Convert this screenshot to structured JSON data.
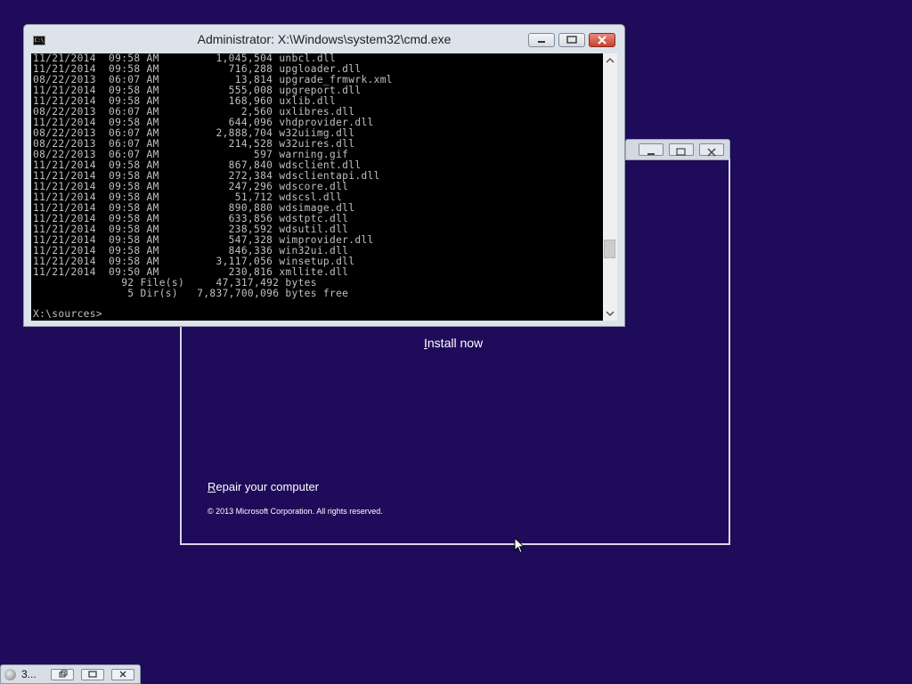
{
  "cmd_window": {
    "title": "Administrator: X:\\Windows\\system32\\cmd.exe",
    "icon": "cmd-icon",
    "buttons": {
      "minimize": "minimize-icon",
      "restore": "restore-icon",
      "close": "close-icon"
    },
    "console_lines": [
      "11/21/2014  09:58 AM         1,045,504 unbcl.dll",
      "11/21/2014  09:58 AM           716,288 upgloader.dll",
      "08/22/2013  06:07 AM            13,814 upgrade_frmwrk.xml",
      "11/21/2014  09:58 AM           555,008 upgreport.dll",
      "11/21/2014  09:58 AM           168,960 uxlib.dll",
      "08/22/2013  06:07 AM             2,560 uxlibres.dll",
      "11/21/2014  09:58 AM           644,096 vhdprovider.dll",
      "08/22/2013  06:07 AM         2,888,704 w32uiimg.dll",
      "08/22/2013  06:07 AM           214,528 w32uires.dll",
      "08/22/2013  06:07 AM               597 warning.gif",
      "11/21/2014  09:58 AM           867,840 wdsclient.dll",
      "11/21/2014  09:58 AM           272,384 wdsclientapi.dll",
      "11/21/2014  09:58 AM           247,296 wdscore.dll",
      "11/21/2014  09:58 AM            51,712 wdscsl.dll",
      "11/21/2014  09:58 AM           890,880 wdsimage.dll",
      "11/21/2014  09:58 AM           633,856 wdstptc.dll",
      "11/21/2014  09:58 AM           238,592 wdsutil.dll",
      "11/21/2014  09:58 AM           547,328 wimprovider.dll",
      "11/21/2014  09:58 AM           846,336 win32ui.dll",
      "11/21/2014  09:58 AM         3,117,056 winsetup.dll",
      "11/21/2014  09:50 AM           230,816 xmllite.dll",
      "              92 File(s)     47,317,492 bytes",
      "               5 Dir(s)   7,837,700,096 bytes free"
    ],
    "prompt": "X:\\sources>",
    "scrollbar": {
      "up_icon": "scroll-up-arrow-icon",
      "down_icon": "scroll-down-arrow-icon"
    }
  },
  "setup_window": {
    "install_accel": "I",
    "install_rest": "nstall now",
    "repair_accel": "R",
    "repair_rest": "epair your computer",
    "copyright": "© 2013 Microsoft Corporation. All rights reserved."
  },
  "minimized_window": {
    "label": "3...",
    "icon": "setup-disc-icon"
  },
  "colors": {
    "desktop_background": "#1e0b5a",
    "console_background": "#000000",
    "console_text": "#c0c0c0",
    "close_button": "#c7442f"
  }
}
